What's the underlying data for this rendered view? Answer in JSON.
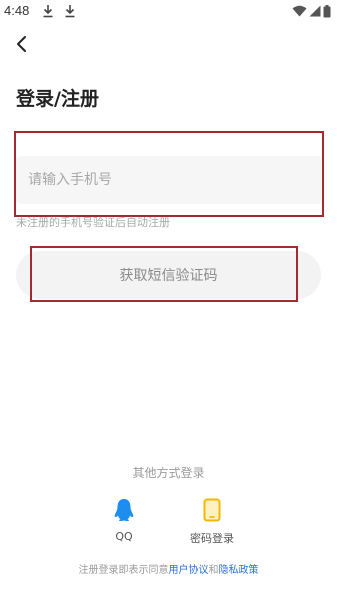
{
  "status_bar": {
    "time": "4:48",
    "icons": [
      "download-icon",
      "download-icon",
      "wifi-icon",
      "signal-icon",
      "battery-icon"
    ]
  },
  "header": {
    "back_icon": "chevron-left-icon",
    "title": "登录/注册"
  },
  "phone": {
    "placeholder": "请输入手机号",
    "value": "",
    "hint": "未注册的手机号验证后自动注册"
  },
  "get_code_button": "获取短信验证码",
  "other_methods": {
    "label": "其他方式登录",
    "options": [
      {
        "label": "QQ",
        "icon": "qq-icon",
        "color": "#1e8df0"
      },
      {
        "label": "密码登录",
        "icon": "phone-device-icon",
        "color": "#f5b800"
      }
    ]
  },
  "agreement": {
    "prefix": "注册登录即表示同意",
    "user_agreement": "用户协议",
    "and": "和",
    "privacy_policy": "隐私政策"
  },
  "colors": {
    "annotation_box": "#a42a2e",
    "link": "#2a70d8"
  }
}
